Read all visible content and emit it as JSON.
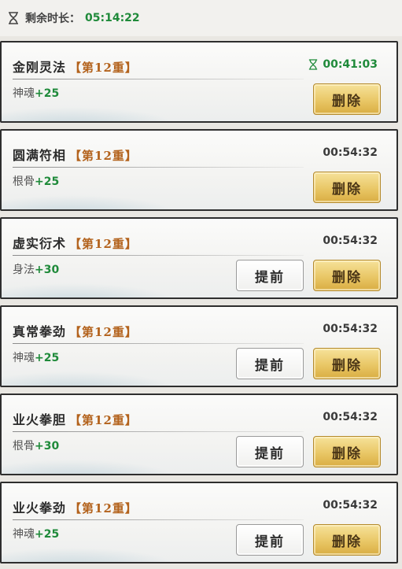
{
  "header": {
    "hourglass_icon": "hourglass-icon",
    "label": "剩余时长：",
    "value": "05:14:22"
  },
  "colors": {
    "accent_green": "#1f8a3a",
    "tier_orange": "#b3621c",
    "delete_gold": "#e9c766"
  },
  "cards": [
    {
      "name": "金刚灵法",
      "tier": "【第12重】",
      "bonus_label": "神魂",
      "bonus_value": "+25",
      "time": "00:41:03",
      "active": true,
      "advance": "",
      "delete": "删除"
    },
    {
      "name": "圆满符相",
      "tier": "【第12重】",
      "bonus_label": "根骨",
      "bonus_value": "+25",
      "time": "00:54:32",
      "active": false,
      "advance": "",
      "delete": "删除"
    },
    {
      "name": "虚实衍术",
      "tier": "【第12重】",
      "bonus_label": "身法",
      "bonus_value": "+30",
      "time": "00:54:32",
      "active": false,
      "advance": "提前",
      "delete": "删除"
    },
    {
      "name": "真常拳劲",
      "tier": "【第12重】",
      "bonus_label": "神魂",
      "bonus_value": "+25",
      "time": "00:54:32",
      "active": false,
      "advance": "提前",
      "delete": "删除"
    },
    {
      "name": "业火拳胆",
      "tier": "【第12重】",
      "bonus_label": "根骨",
      "bonus_value": "+30",
      "time": "00:54:32",
      "active": false,
      "advance": "提前",
      "delete": "删除"
    },
    {
      "name": "业火拳劲",
      "tier": "【第12重】",
      "bonus_label": "神魂",
      "bonus_value": "+25",
      "time": "00:54:32",
      "active": false,
      "advance": "提前",
      "delete": "删除"
    }
  ]
}
